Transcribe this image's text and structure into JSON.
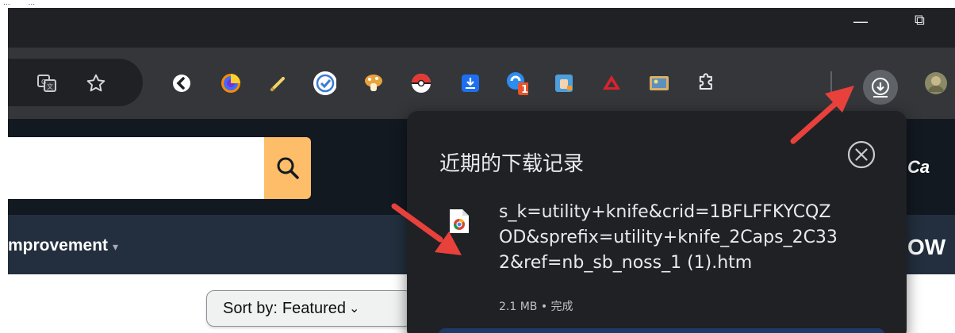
{
  "top_fragment": "...        ...",
  "window": {
    "minimize_glyph": "—",
    "restore_glyph": "⧉"
  },
  "toolbar": {
    "translate_icon": "translate-icon",
    "bookmark_icon": "star-icon",
    "extensions": [
      "back-arrow-icon",
      "color-wheel-icon",
      "pen-icon",
      "checkmark-badge-icon",
      "mushroom-icon",
      "pokeball-icon",
      "blue-download-icon",
      "notify-icon",
      "fist-icon",
      "triangle-icon",
      "photo-icon",
      "puzzle-icon"
    ],
    "notification_badge": "1",
    "download_icon": "download-icon",
    "avatar_icon": "avatar-icon"
  },
  "page": {
    "nav_text": "mprovement",
    "nav_caret": "▾",
    "right_brand": "Ca",
    "right_brand_2": "OW",
    "sort_label": "Sort by:",
    "sort_value": "Featured",
    "sort_chevron": "⌄"
  },
  "downloads": {
    "title": "近期的下载记录",
    "file_name": "s_k=utility+knife&crid=1BFLFFKYCQZ\nOD&sprefix=utility+knife_2Caps_2C33\n2&ref=nb_sb_noss_1 (1).htm",
    "status": "2.1 MB • 完成"
  },
  "colors": {
    "titlebar": "#202124",
    "toolbar": "#35363a",
    "amazon_dark": "#131921",
    "amazon_nav": "#232f3e",
    "search_orange": "#febd69",
    "bubble_bg": "#202124",
    "arrow_red": "#e8413c"
  }
}
